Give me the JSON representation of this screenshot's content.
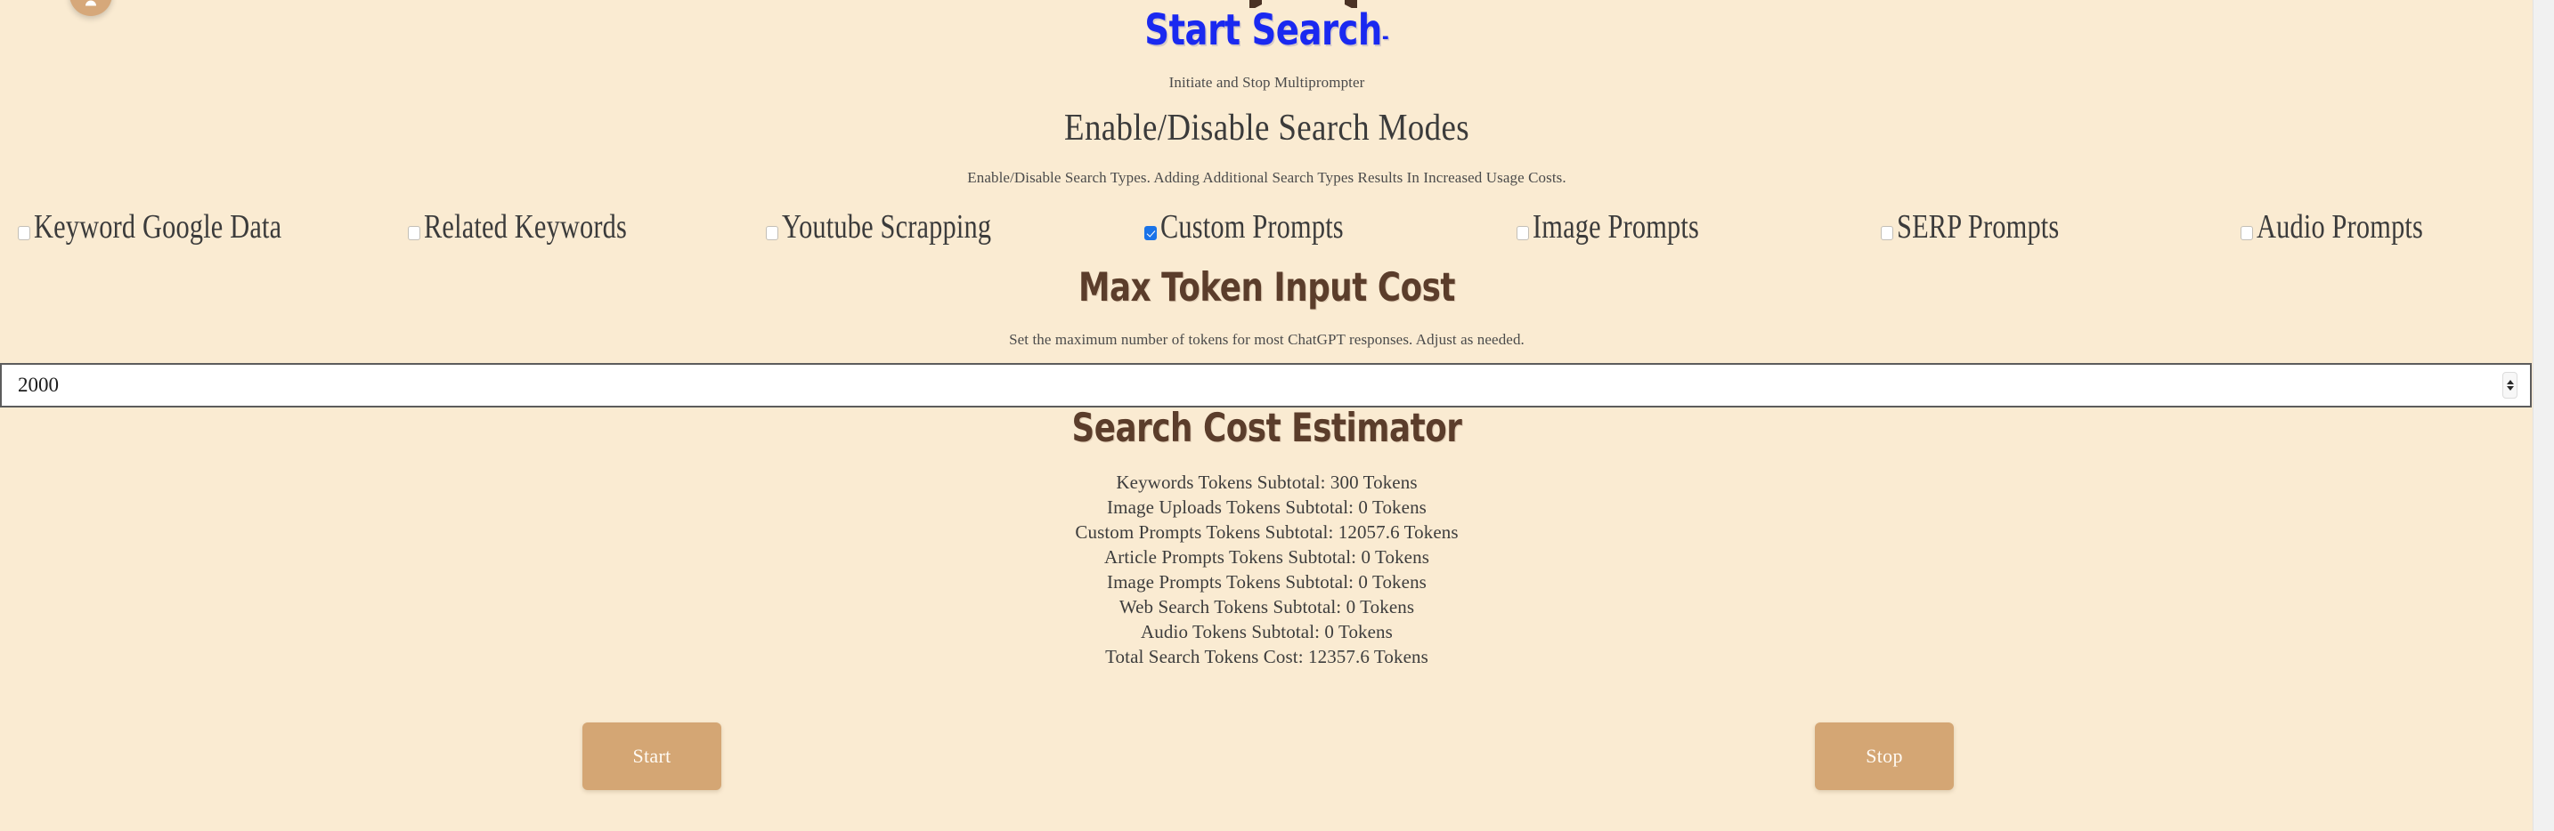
{
  "app": {
    "background_color": "#faebd2",
    "orb": {
      "icon": "user-avatar-icon"
    }
  },
  "start_search": {
    "title": "Start Search",
    "title_trailing": "-",
    "title_color": "#1a29f0",
    "subtitle": "Initiate and Stop Multiprompter"
  },
  "search_modes": {
    "heading": "Enable/Disable Search Modes",
    "subtitle": "Enable/Disable Search Types. Adding Additional Search Types Results In Increased Usage Costs.",
    "checked_color": "#1a73e8",
    "items": [
      {
        "label": "Keyword Google Data",
        "checked": false
      },
      {
        "label": "Related Keywords",
        "checked": false
      },
      {
        "label": "Youtube Scrapping",
        "checked": false
      },
      {
        "label": "Custom Prompts",
        "checked": true
      },
      {
        "label": "Image Prompts",
        "checked": false
      },
      {
        "label": "SERP Prompts",
        "checked": false
      },
      {
        "label": "Audio Prompts",
        "checked": false
      }
    ]
  },
  "max_token": {
    "heading": "Max Token Input Cost",
    "heading_color": "#5b3d2b",
    "subtitle": "Set the maximum number of tokens for most ChatGPT responses. Adjust as needed.",
    "input_value": "2000",
    "input_placeholder": "2000",
    "spinner_up_icon": "chevron-up-icon",
    "spinner_down_icon": "chevron-down-icon"
  },
  "cost_estimator": {
    "heading": "Search Cost Estimator",
    "heading_color": "#5b3d2b",
    "lines": [
      "Keywords Tokens Subtotal: 300 Tokens",
      "Image Uploads Tokens Subtotal: 0 Tokens",
      "Custom Prompts Tokens Subtotal: 12057.6 Tokens",
      "Article Prompts Tokens Subtotal: 0 Tokens",
      "Image Prompts Tokens Subtotal: 0 Tokens",
      "Web Search Tokens Subtotal: 0 Tokens",
      "Audio Tokens Subtotal: 0 Tokens",
      "Total Search Tokens Cost: 12357.6 Tokens"
    ],
    "totals": {
      "keywords_tokens": 300,
      "image_uploads_tokens": 0,
      "custom_prompts_tokens": 12057.6,
      "article_prompts_tokens": 0,
      "image_prompts_tokens": 0,
      "web_search_tokens": 0,
      "audio_tokens": 0,
      "total_tokens": 12357.6
    }
  },
  "actions": {
    "start_label": "Start",
    "stop_label": "Stop",
    "button_color": "#d4a674"
  }
}
